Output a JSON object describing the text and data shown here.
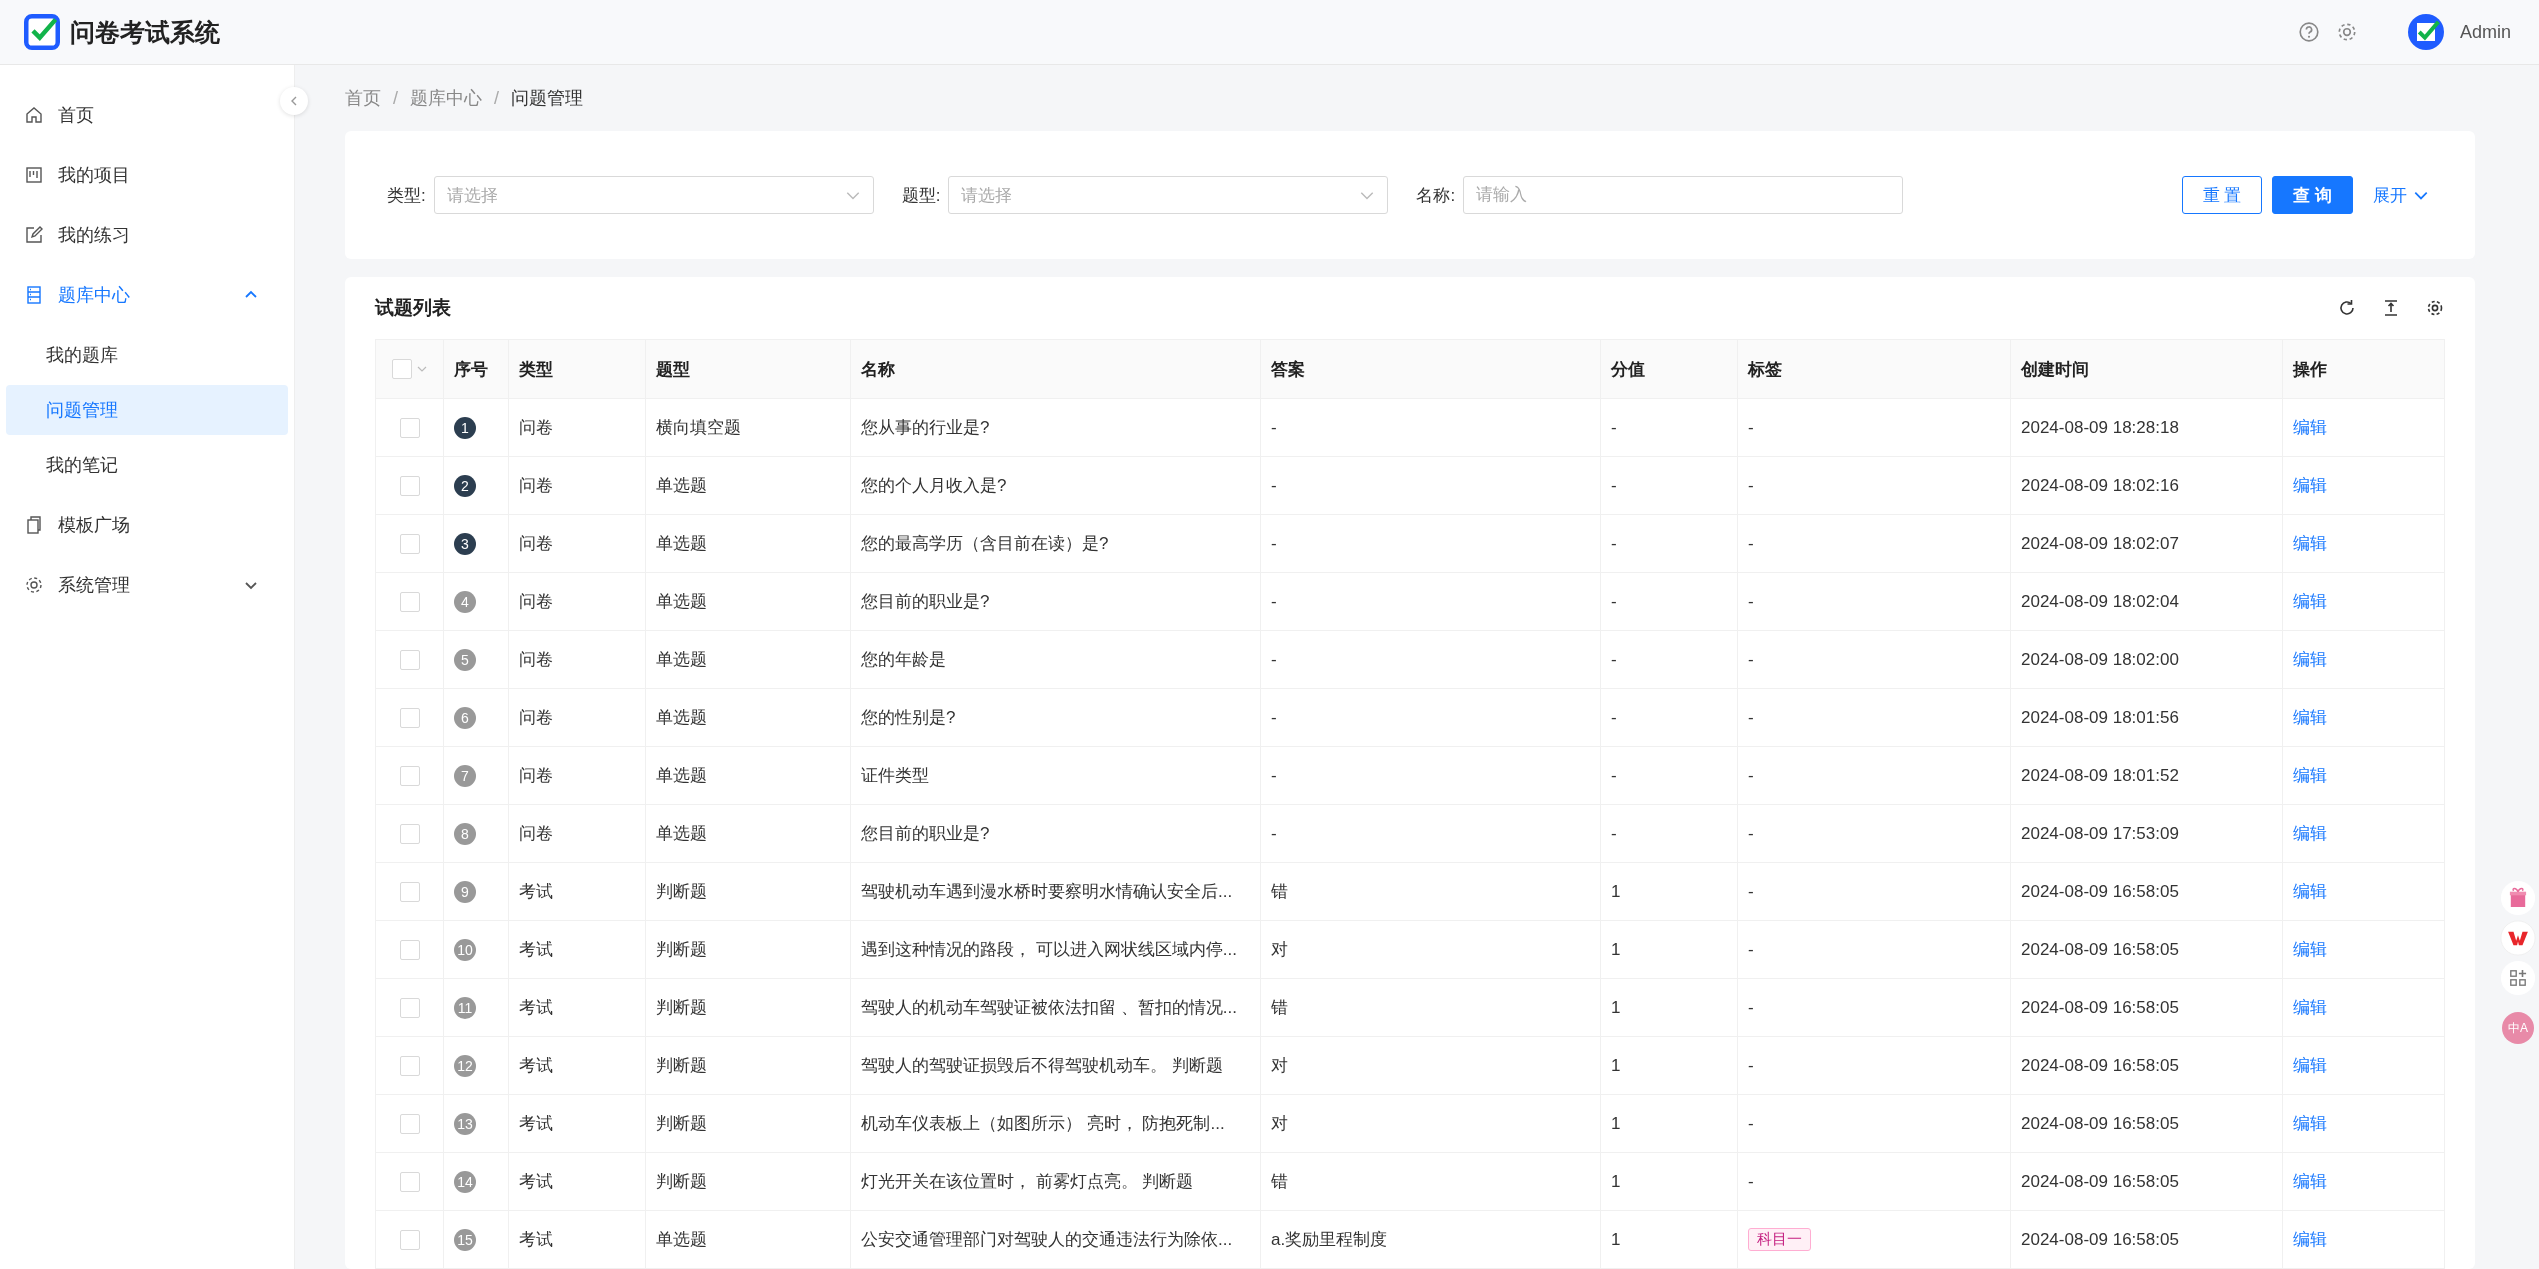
{
  "app": {
    "title": "问卷考试系统",
    "user": "Admin"
  },
  "sidebar": {
    "items": [
      {
        "label": "首页"
      },
      {
        "label": "我的项目"
      },
      {
        "label": "我的练习"
      },
      {
        "label": "题库中心",
        "expanded": true,
        "children": [
          {
            "label": "我的题库",
            "selected": false
          },
          {
            "label": "问题管理",
            "selected": true
          },
          {
            "label": "我的笔记",
            "selected": false
          }
        ]
      },
      {
        "label": "模板广场"
      },
      {
        "label": "系统管理",
        "expanded": false
      }
    ]
  },
  "breadcrumb": {
    "separator": "/",
    "items": [
      "首页",
      "题库中心",
      "问题管理"
    ]
  },
  "filters": [
    {
      "label": "类型:",
      "kind": "select",
      "placeholder": "请选择"
    },
    {
      "label": "题型:",
      "kind": "select",
      "placeholder": "请选择"
    },
    {
      "label": "名称:",
      "kind": "input",
      "placeholder": "请输入"
    }
  ],
  "filter_buttons": {
    "reset": "重 置",
    "search": "查 询",
    "expand": "展开"
  },
  "table": {
    "title": "试题列表",
    "select_all_checked": false,
    "columns": [
      "序号",
      "类型",
      "题型",
      "名称",
      "答案",
      "分值",
      "标签",
      "创建时间",
      "操作"
    ],
    "rows": [
      {
        "checked": false,
        "index": "1",
        "top": true,
        "type": "问卷",
        "qtype": "横向填空题",
        "name": "您从事的行业是?",
        "answer": "-",
        "score": "-",
        "tag": "-",
        "tag_badge": false,
        "created": "2024-08-09 18:28:18",
        "action": "编辑"
      },
      {
        "checked": false,
        "index": "2",
        "top": true,
        "type": "问卷",
        "qtype": "单选题",
        "name": "您的个人月收入是?",
        "answer": "-",
        "score": "-",
        "tag": "-",
        "tag_badge": false,
        "created": "2024-08-09 18:02:16",
        "action": "编辑"
      },
      {
        "checked": false,
        "index": "3",
        "top": true,
        "type": "问卷",
        "qtype": "单选题",
        "name": "您的最高学历（含目前在读）是?",
        "answer": "-",
        "score": "-",
        "tag": "-",
        "tag_badge": false,
        "created": "2024-08-09 18:02:07",
        "action": "编辑"
      },
      {
        "checked": false,
        "index": "4",
        "top": false,
        "type": "问卷",
        "qtype": "单选题",
        "name": "您目前的职业是?",
        "answer": "-",
        "score": "-",
        "tag": "-",
        "tag_badge": false,
        "created": "2024-08-09 18:02:04",
        "action": "编辑"
      },
      {
        "checked": false,
        "index": "5",
        "top": false,
        "type": "问卷",
        "qtype": "单选题",
        "name": "您的年龄是",
        "answer": "-",
        "score": "-",
        "tag": "-",
        "tag_badge": false,
        "created": "2024-08-09 18:02:00",
        "action": "编辑"
      },
      {
        "checked": false,
        "index": "6",
        "top": false,
        "type": "问卷",
        "qtype": "单选题",
        "name": "您的性别是?",
        "answer": "-",
        "score": "-",
        "tag": "-",
        "tag_badge": false,
        "created": "2024-08-09 18:01:56",
        "action": "编辑"
      },
      {
        "checked": false,
        "index": "7",
        "top": false,
        "type": "问卷",
        "qtype": "单选题",
        "name": "证件类型",
        "answer": "-",
        "score": "-",
        "tag": "-",
        "tag_badge": false,
        "created": "2024-08-09 18:01:52",
        "action": "编辑"
      },
      {
        "checked": false,
        "index": "8",
        "top": false,
        "type": "问卷",
        "qtype": "单选题",
        "name": "您目前的职业是?",
        "answer": "-",
        "score": "-",
        "tag": "-",
        "tag_badge": false,
        "created": "2024-08-09 17:53:09",
        "action": "编辑"
      },
      {
        "checked": false,
        "index": "9",
        "top": false,
        "type": "考试",
        "qtype": "判断题",
        "name": "驾驶机动车遇到漫水桥时要察明水情确认安全后...",
        "answer": "错",
        "score": "1",
        "tag": "-",
        "tag_badge": false,
        "created": "2024-08-09 16:58:05",
        "action": "编辑"
      },
      {
        "checked": false,
        "index": "10",
        "top": false,
        "type": "考试",
        "qtype": "判断题",
        "name": "遇到这种情况的路段， 可以进入网状线区域内停...",
        "answer": "对",
        "score": "1",
        "tag": "-",
        "tag_badge": false,
        "created": "2024-08-09 16:58:05",
        "action": "编辑"
      },
      {
        "checked": false,
        "index": "11",
        "top": false,
        "type": "考试",
        "qtype": "判断题",
        "name": "驾驶人的机动车驾驶证被依法扣留 、暂扣的情况...",
        "answer": "错",
        "score": "1",
        "tag": "-",
        "tag_badge": false,
        "created": "2024-08-09 16:58:05",
        "action": "编辑"
      },
      {
        "checked": false,
        "index": "12",
        "top": false,
        "type": "考试",
        "qtype": "判断题",
        "name": "驾驶人的驾驶证损毁后不得驾驶机动车。 判断题",
        "answer": "对",
        "score": "1",
        "tag": "-",
        "tag_badge": false,
        "created": "2024-08-09 16:58:05",
        "action": "编辑"
      },
      {
        "checked": false,
        "index": "13",
        "top": false,
        "type": "考试",
        "qtype": "判断题",
        "name": "机动车仪表板上（如图所示） 亮时， 防抱死制...",
        "answer": "对",
        "score": "1",
        "tag": "-",
        "tag_badge": false,
        "created": "2024-08-09 16:58:05",
        "action": "编辑"
      },
      {
        "checked": false,
        "index": "14",
        "top": false,
        "type": "考试",
        "qtype": "判断题",
        "name": "灯光开关在该位置时， 前雾灯点亮。 判断题",
        "answer": "错",
        "score": "1",
        "tag": "-",
        "tag_badge": false,
        "created": "2024-08-09 16:58:05",
        "action": "编辑"
      },
      {
        "checked": false,
        "index": "15",
        "top": false,
        "type": "考试",
        "qtype": "单选题",
        "name": "公安交通管理部门对驾驶人的交通违法行为除依...",
        "answer": "a.奖励里程制度",
        "score": "1",
        "tag": "科目一",
        "tag_badge": true,
        "created": "2024-08-09 16:58:05",
        "action": "编辑"
      }
    ]
  },
  "floating_tools": {
    "translate": "中A"
  }
}
